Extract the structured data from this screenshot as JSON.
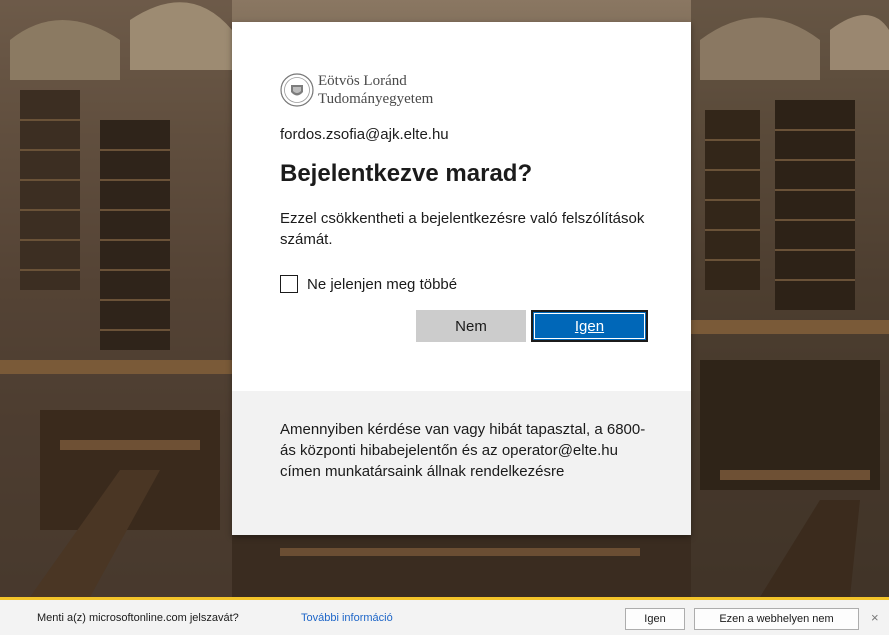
{
  "org": {
    "name_line1": "Eötvös Loránd",
    "name_line2": "Tudományegyetem"
  },
  "dialog": {
    "account": "fordos.zsofia@ajk.elte.hu",
    "title": "Bejelentkezve marad?",
    "description": "Ezzel csökkentheti a bejelentkezésre való felszólítások számát.",
    "checkbox_label": "Ne jelenjen meg többé",
    "checkbox_checked": false,
    "no_label": "Nem",
    "yes_label": "Igen",
    "primary_color": "#0067b8",
    "footer_text": "Amennyiben kérdése van vagy hibát tapasztal, a 6800-ás központi hibabejelentőn és az operator@elte.hu címen munkatársaink állnak rendelkezésre"
  },
  "password_bar": {
    "message": "Menti a(z) microsoftonline.com jelszavát?",
    "more_info": "További információ",
    "yes_label": "Igen",
    "never_label": "Ezen a webhelyen nem",
    "close_glyph": "×",
    "accent_color": "#f3c42a"
  }
}
